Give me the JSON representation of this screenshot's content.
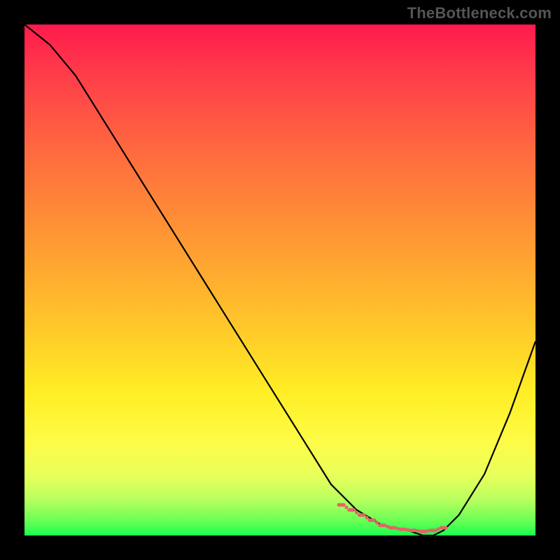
{
  "watermark": "TheBottleneck.com",
  "chart_data": {
    "type": "line",
    "title": "",
    "xlabel": "",
    "ylabel": "",
    "xlim": [
      0,
      100
    ],
    "ylim": [
      0,
      100
    ],
    "grid": false,
    "legend": false,
    "colors": {
      "curve": "#000000",
      "markers": "#e06666",
      "gradient_top": "#ff1a4d",
      "gradient_bottom": "#1aff4d",
      "frame": "#000000"
    },
    "series": [
      {
        "name": "bottleneck-curve",
        "x": [
          0,
          5,
          10,
          15,
          20,
          25,
          30,
          35,
          40,
          45,
          50,
          55,
          60,
          62,
          65,
          70,
          75,
          78,
          80,
          82,
          85,
          90,
          95,
          100
        ],
        "y": [
          100,
          96,
          90,
          82,
          74,
          66,
          58,
          50,
          42,
          34,
          26,
          18,
          10,
          8,
          5,
          2,
          1,
          0,
          0,
          1,
          4,
          12,
          24,
          38
        ]
      }
    ],
    "markers": {
      "name": "flat-valley-points",
      "x": [
        62,
        64,
        66,
        68,
        70,
        72,
        74,
        76,
        78,
        80,
        82
      ],
      "y": [
        6,
        5,
        4,
        3,
        2,
        1.5,
        1.2,
        1,
        0.8,
        1,
        1.5
      ]
    }
  }
}
